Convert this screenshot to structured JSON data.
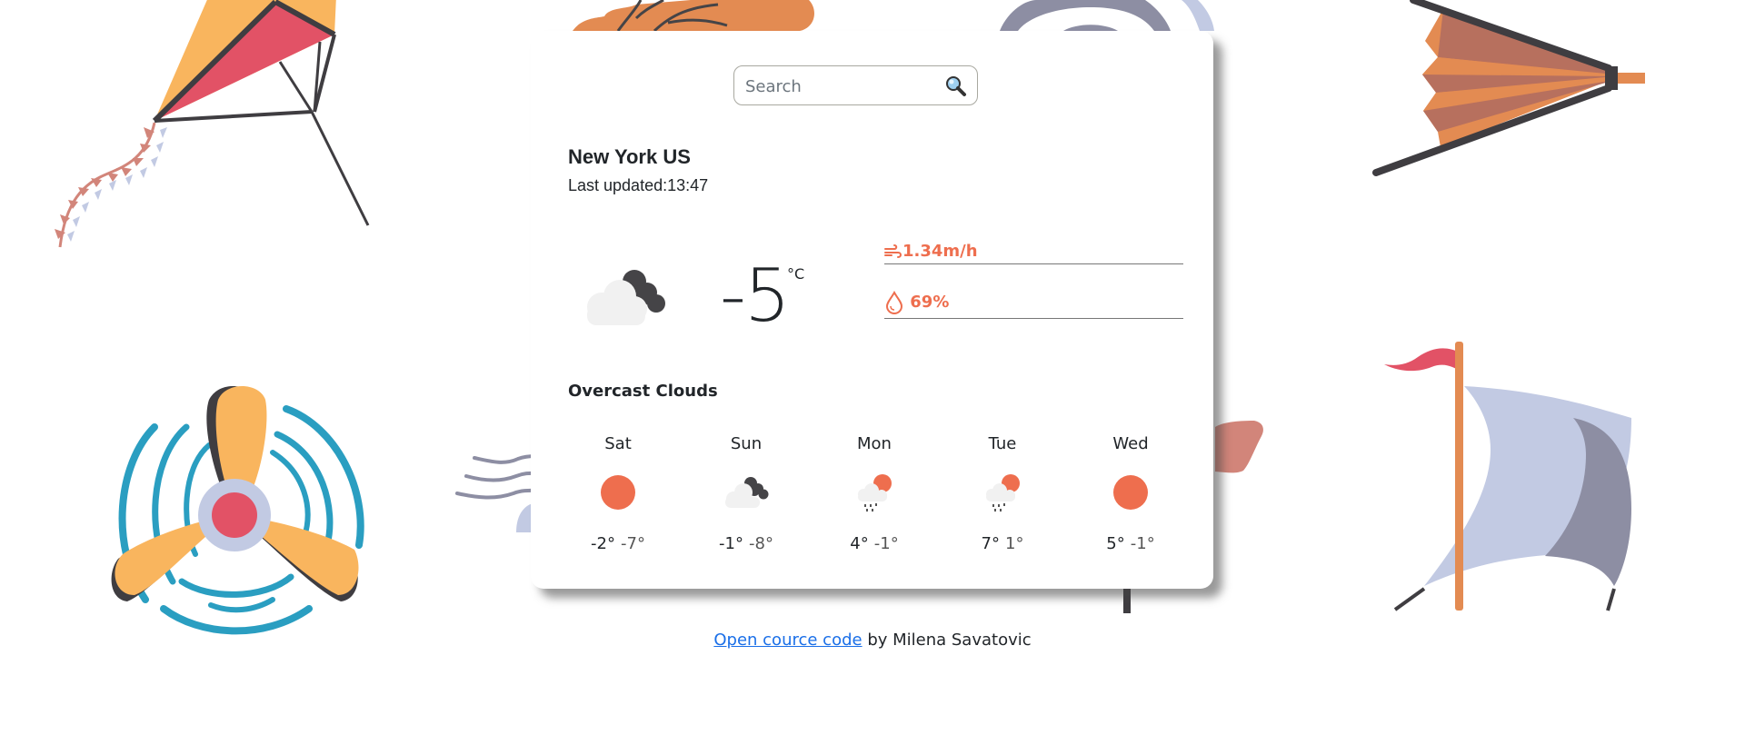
{
  "search": {
    "placeholder": "Search",
    "value": "",
    "icon": "magnifier-icon"
  },
  "location": {
    "city": "New York US",
    "last_updated": "Last updated:13:47"
  },
  "current": {
    "icon": "overcast-clouds-icon",
    "temperature": "-5",
    "unit": "°C",
    "wind": "1.34m/h",
    "wind_icon": "wind-icon",
    "humidity": "69%",
    "humidity_icon": "droplet-icon",
    "description": "Overcast Clouds"
  },
  "forecast": [
    {
      "day": "Sat",
      "icon": "sun-icon",
      "max": "-2°",
      "min": "-7°"
    },
    {
      "day": "Sun",
      "icon": "overcast-clouds-icon",
      "max": "-1°",
      "min": "-8°"
    },
    {
      "day": "Mon",
      "icon": "rain-sun-icon",
      "max": "4°",
      "min": "-1°"
    },
    {
      "day": "Tue",
      "icon": "rain-sun-icon",
      "max": "7°",
      "min": "1°"
    },
    {
      "day": "Wed",
      "icon": "sun-icon",
      "max": "5°",
      "min": "-1°"
    }
  ],
  "footer": {
    "link_text": "Open cource code",
    "suffix": " by Milena Savatovic"
  },
  "colors": {
    "accent": "#ee6e4e",
    "text": "#212529",
    "link": "#1a6fe8",
    "sun": "#ee6e4e",
    "cloud_light": "#f1f1f1",
    "cloud_dark": "#454447"
  }
}
